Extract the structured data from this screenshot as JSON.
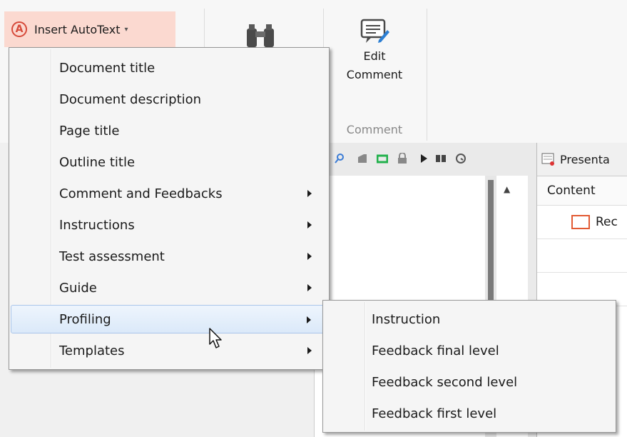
{
  "ribbon": {
    "insert_autotext": {
      "label": "Insert AutoText",
      "icon_letter": "A",
      "caret": "▾"
    },
    "edit_comment": {
      "line1": "Edit",
      "line2": "Comment"
    },
    "group_label": "Comment",
    "accent_color": "#d64a3a"
  },
  "presentation_panel": {
    "title": "Presenta",
    "column_header": "Content",
    "rows": [
      "Rec"
    ]
  },
  "main_menu": {
    "items": [
      {
        "label": "Document title",
        "submenu": false
      },
      {
        "label": "Document description",
        "submenu": false
      },
      {
        "label": "Page title",
        "submenu": false
      },
      {
        "label": "Outline title",
        "submenu": false
      },
      {
        "label": "Comment and Feedbacks",
        "submenu": true
      },
      {
        "label": "Instructions",
        "submenu": true
      },
      {
        "label": "Test assessment",
        "submenu": true
      },
      {
        "label": "Guide",
        "submenu": true
      },
      {
        "label": "Profiling",
        "submenu": true,
        "highlighted": true
      },
      {
        "label": "Templates",
        "submenu": true
      }
    ]
  },
  "sub_menu": {
    "parent": "Profiling",
    "items": [
      {
        "label": "Instruction"
      },
      {
        "label": "Feedback final level"
      },
      {
        "label": "Feedback second level"
      },
      {
        "label": "Feedback first level"
      }
    ]
  },
  "icons": [
    "a-circle-icon",
    "binoculars-icon",
    "edit-comment-icon",
    "mouse-pointer-icon",
    "submenu-arrow-icon"
  ]
}
